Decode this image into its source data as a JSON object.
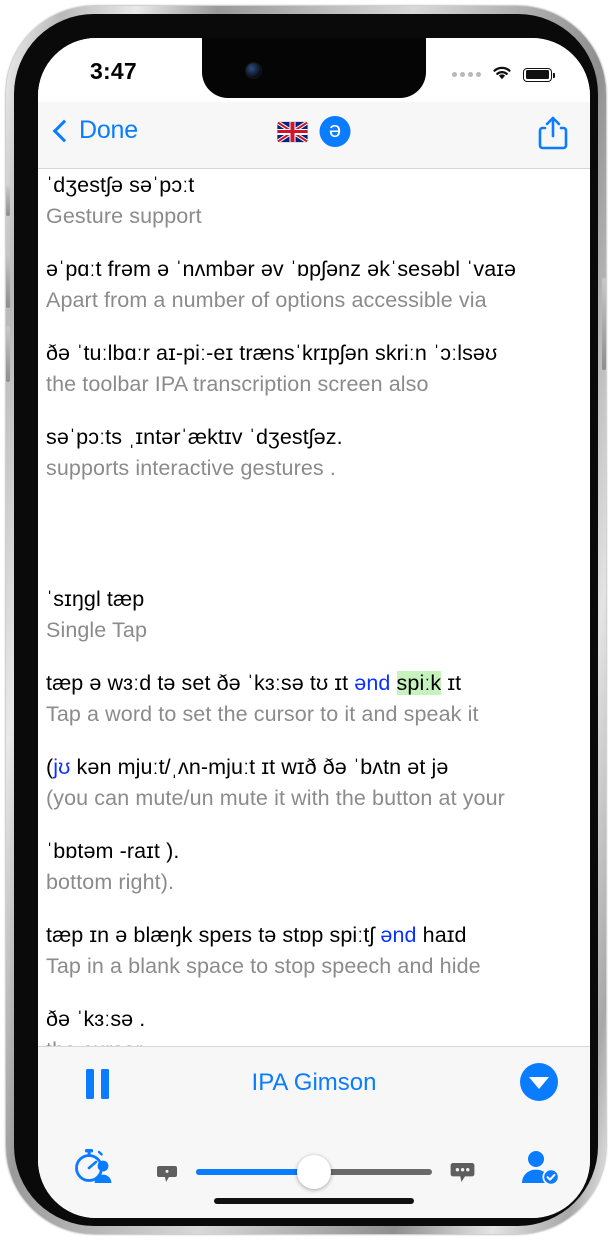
{
  "status_bar": {
    "time": "3:47",
    "signal_dots": 4,
    "wifi_icon": "wifi-icon",
    "battery_icon": "battery-full-icon"
  },
  "nav_bar": {
    "back_label": "Done",
    "back_chevron_icon": "chevron-left-icon",
    "flag_icon": "uk-flag-icon",
    "ipa_badge_glyph": "ə",
    "share_icon": "share-icon",
    "accent_color": "#0a7cff"
  },
  "content": {
    "blocks": [
      {
        "ipa": "ˈdʒestʃə səˈpɔːt",
        "gloss": "Gesture support",
        "segments": [
          {
            "text": "ˈdʒestʃə səˈpɔːt",
            "style": "plain"
          }
        ]
      },
      {
        "ipa": "əˈpɑːt frəm ə ˈnʌmbər əv ˈɒpʃənz əkˈsesəbl   ˈvaɪə",
        "gloss": "Apart from a number of  options accessible via",
        "segments": [
          {
            "text": "əˈpɑːt frəm ə ˈnʌmbər əv ˈɒpʃənz əkˈsesəbl   ˈvaɪə",
            "style": "plain"
          }
        ]
      },
      {
        "ipa": "ðə  ˈtuːlbɑːr aɪ-piː-eɪ trænsˈkrɪpʃən skriːn   ˈɔːlsəʊ",
        "gloss": "the toolbar IPA        transcription  screen also",
        "segments": [
          {
            "text": "ðə  ˈtuːlbɑːr aɪ-piː-eɪ trænsˈkrɪpʃən skriːn   ˈɔːlsəʊ",
            "style": "plain"
          }
        ]
      },
      {
        "ipa": "səˈpɔːts   ˌɪntərˈæktɪv ˈdʒestʃəz.",
        "gloss": "supports interactive  gestures .",
        "segments": [
          {
            "text": "səˈpɔːts   ˌɪntərˈæktɪv ˈdʒestʃəz.",
            "style": "plain"
          }
        ]
      },
      {
        "ipa": "ˈsɪŋgl  tæp",
        "gloss": "Single Tap",
        "spacer_before": true,
        "segments": [
          {
            "text": "ˈsɪŋgl  tæp",
            "style": "plain"
          }
        ]
      },
      {
        "ipa": "tæp ə wɜːd tə set ðə  ˈkɜːsə  tʊ ɪt ənd spiːk   ɪt",
        "gloss": "Tap a word to set the cursor to it and speak it",
        "segments": [
          {
            "text": "tæp ə wɜːd tə set ðə  ˈkɜːsə  tʊ ɪt ",
            "style": "plain"
          },
          {
            "text": "ənd",
            "style": "blue"
          },
          {
            "text": " ",
            "style": "plain"
          },
          {
            "text": "spiːk",
            "style": "highlight"
          },
          {
            "text": "   ɪt",
            "style": "plain"
          }
        ]
      },
      {
        "ipa": "(jʊ   kən mjuːt/ˌʌn-mjuːt ɪt wɪð ðə  ˈbʌtn   ət jə",
        "gloss": "(you can mute/un  mute it with the button at your",
        "segments": [
          {
            "text": "(",
            "style": "plain"
          },
          {
            "text": "jʊ",
            "style": "blue"
          },
          {
            "text": "   kən mjuːt/ˌʌn-mjuːt ɪt wɪð ðə  ˈbʌtn   ət jə",
            "style": "plain"
          }
        ]
      },
      {
        "ipa": "ˈbɒtəm -raɪt  ).",
        "gloss": "bottom right).",
        "segments": [
          {
            "text": "ˈbɒtəm -raɪt  ).",
            "style": "plain"
          }
        ]
      },
      {
        "ipa": "tæp ɪn ə blæŋk speɪs tə stɒp spiːtʃ   ənd haɪd",
        "gloss": "Tap in a blank  space to stop speech and hide",
        "segments": [
          {
            "text": "tæp ɪn ə blæŋk speɪs tə stɒp spiːtʃ    ",
            "style": "plain"
          },
          {
            "text": "ənd",
            "style": "blue"
          },
          {
            "text": " haɪd",
            "style": "plain"
          }
        ]
      },
      {
        "ipa": "ðə  ˈkɜːsə .",
        "gloss": "the cursor.",
        "segments": [
          {
            "text": "ðə  ˈkɜːsə .",
            "style": "plain"
          }
        ]
      }
    ],
    "highlight_color": "#c6f2bd",
    "blue_word_color": "#0a32ff",
    "gloss_color": "#8b8b8b"
  },
  "toolbar": {
    "pause_icon": "pause-icon",
    "voice_name": "IPA Gimson",
    "collapse_icon": "chevron-down-circle-icon",
    "timer_icon": "stopwatch-person-icon",
    "speech_slow_icon": "speech-bubble-small-icon",
    "speech_fast_icon": "speech-bubble-large-icon",
    "speed_slider_value": 50,
    "person_check_icon": "person-check-icon"
  },
  "home_indicator": "home-indicator"
}
